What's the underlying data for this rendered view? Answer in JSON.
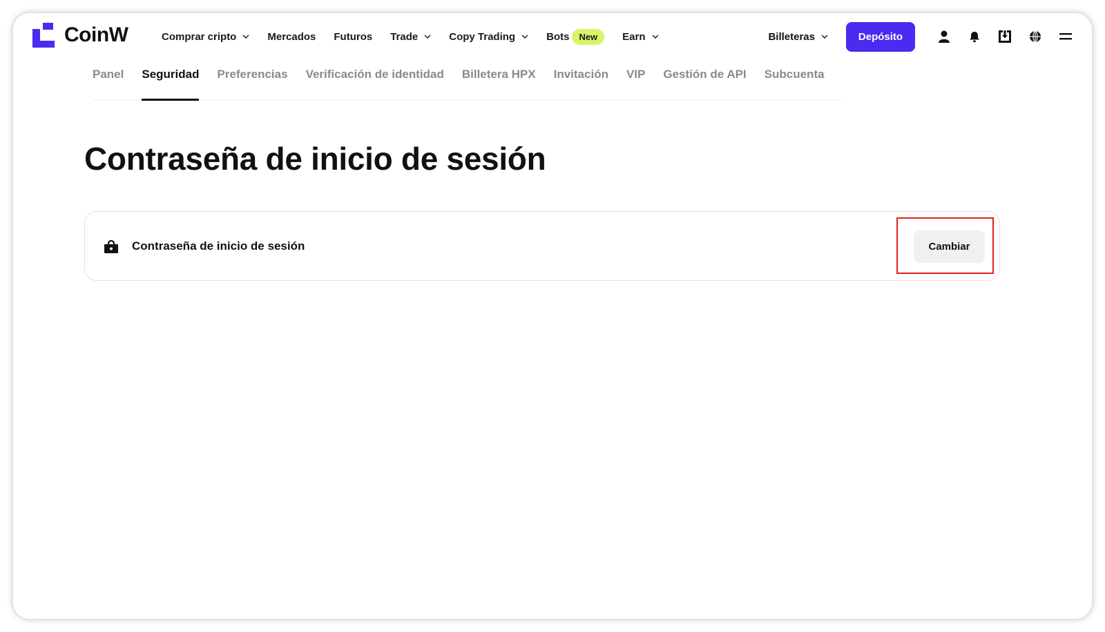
{
  "brand": {
    "name": "CoinW",
    "color": "#4a2bef",
    "icon": "coinw-logo-icon"
  },
  "nav": {
    "items": [
      {
        "label": "Comprar cripto",
        "dropdown": true
      },
      {
        "label": "Mercados",
        "dropdown": false
      },
      {
        "label": "Futuros",
        "dropdown": false
      },
      {
        "label": "Trade",
        "dropdown": true
      },
      {
        "label": "Copy Trading",
        "dropdown": true
      },
      {
        "label": "Bots",
        "badge": "New",
        "dropdown": false
      },
      {
        "label": "Earn",
        "dropdown": true
      }
    ],
    "wallets_label": "Billeteras",
    "deposit_label": "Depósito",
    "icons": [
      "user-icon",
      "bell-icon",
      "download-icon",
      "globe-icon",
      "menu-icon"
    ]
  },
  "tabs": {
    "active": "Seguridad",
    "items": [
      "Panel",
      "Seguridad",
      "Preferencias",
      "Verificación de identidad",
      "Billetera HPX",
      "Invitación",
      "VIP",
      "Gestión de API",
      "Subcuenta"
    ]
  },
  "main": {
    "title": "Contraseña de inicio de sesión",
    "card": {
      "icon": "lock-icon",
      "label": "Contraseña de inicio de sesión",
      "button_label": "Cambiar"
    }
  },
  "colors": {
    "accent": "#4a2bef",
    "badge": "#d6f56a",
    "highlight": "#e02020"
  }
}
